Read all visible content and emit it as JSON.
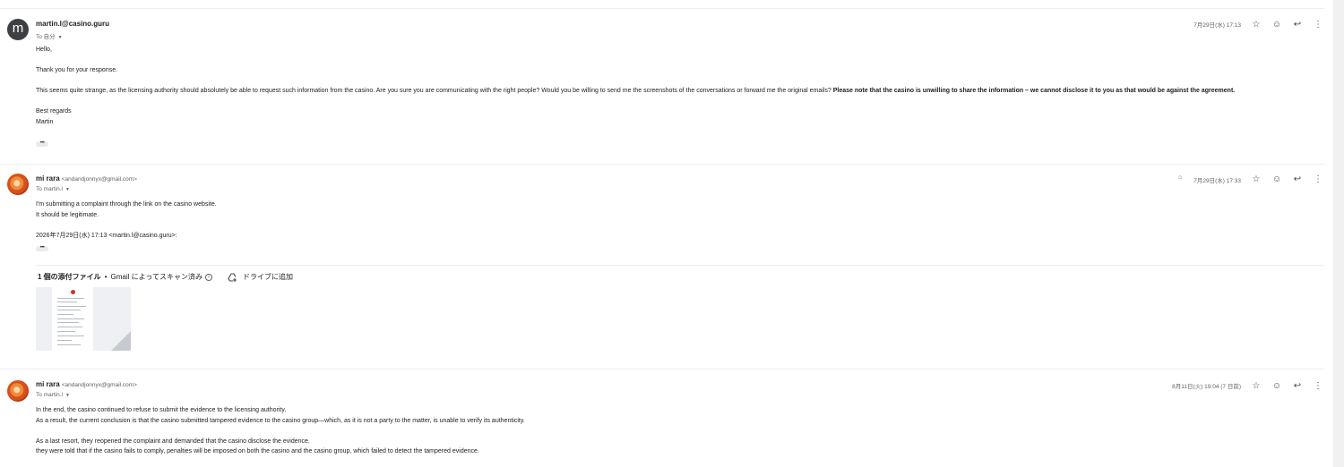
{
  "messages": [
    {
      "sender_name": "martin.l@casino.guru",
      "sender_email": "",
      "avatar_letter": "m",
      "to": "To 自分",
      "date": "7月29日(水) 17:13",
      "body": {
        "greeting": "Hello,",
        "line1": "Thank you for your response.",
        "para_normal": "This seems quite strange, as the licensing authority should absolutely be able to request such information from the casino. Are you sure you are communicating with the right people? Would you be willing to send me the screenshots of the conversations or forward me the original emails? ",
        "para_bold": "Please note that the casino is unwilling to share the information – we cannot disclose it to you as that would be against the agreement.",
        "signoff1": "Best regards",
        "signoff2": "Martin"
      }
    },
    {
      "sender_name": "mi rara",
      "sender_email": "<andandjonnyx@gmail.com>",
      "to": "To martin.l",
      "date": "7月29日(水) 17:33",
      "body": {
        "line1": "I'm submitting a complaint through the link on the casino website.",
        "line2": "It should be legitimate.",
        "quote_header": "2026年7月29日(水) 17:13 <martin.l@casino.guru>:"
      },
      "attachments": {
        "title": "1 個の添付ファイル",
        "scanned": "Gmail によってスキャン済み",
        "add_to_drive": "ドライブに追加"
      }
    },
    {
      "sender_name": "mi rara",
      "sender_email": "<andandjonnyx@gmail.com>",
      "to": "To martin.l",
      "date": "8月11日(火) 19:04 (7 日前)",
      "body": {
        "line1": "In the end, the casino continued to refuse to submit the evidence to the licensing authority.",
        "line2": "As a result, the current conclusion is that the casino submitted tampered evidence to the casino group—which, as it is not a party to the matter, is unable to verify its authenticity.",
        "line3": "As a last resort, they reopened the complaint and demanded that the casino disclose the evidence.",
        "line4": "they were told that if the casino fails to comply, penalties will be imposed on both the casino and the casino group, which failed to detect the tampered evidence."
      }
    }
  ],
  "icons": {
    "star": "star-icon",
    "emoji": "emoji-reaction-icon",
    "reply": "reply-icon",
    "more": "more-vert-icon",
    "label": "label-icon",
    "drive_add": "drive-add-icon",
    "info": "info-icon"
  },
  "colors": {
    "avatar_m": "#3c4043",
    "divider": "#ededed",
    "secondary_text": "#5f6368"
  }
}
